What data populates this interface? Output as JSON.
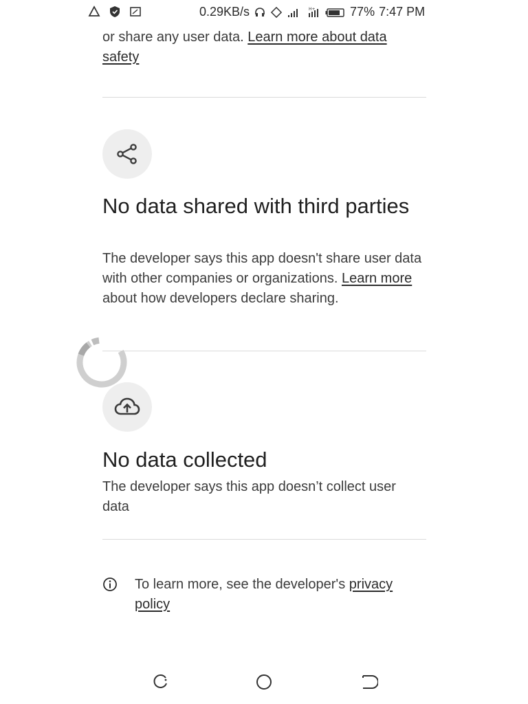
{
  "status_bar": {
    "network_speed": "0.29KB/s",
    "battery": "77%",
    "time": "7:47 PM",
    "icons": [
      "alert-icon",
      "shield-icon",
      "screenshot-icon",
      "headset-icon",
      "rotate-icon",
      "signal-icon",
      "hplus-signal-icon",
      "battery-icon"
    ]
  },
  "top_section": {
    "text": "or share any user data.",
    "link": "Learn more about data safety"
  },
  "sharing_section": {
    "icon": "share-icon",
    "title": "No data shared with third parties",
    "body": "The developer says this app doesn't share user data with other companies or organizations.",
    "link": "Learn more",
    "body_after_link": "about how developers declare sharing."
  },
  "collection_section": {
    "icon": "cloud-upload-icon",
    "title": "No data collected",
    "body": "The developer says this app doesn’t collect user data"
  },
  "footer": {
    "icon": "info-icon",
    "text": "To learn more, see the developer's",
    "link": "privacy policy"
  },
  "nav_bar": {
    "buttons": [
      "recents-icon",
      "home-icon",
      "back-icon"
    ]
  }
}
